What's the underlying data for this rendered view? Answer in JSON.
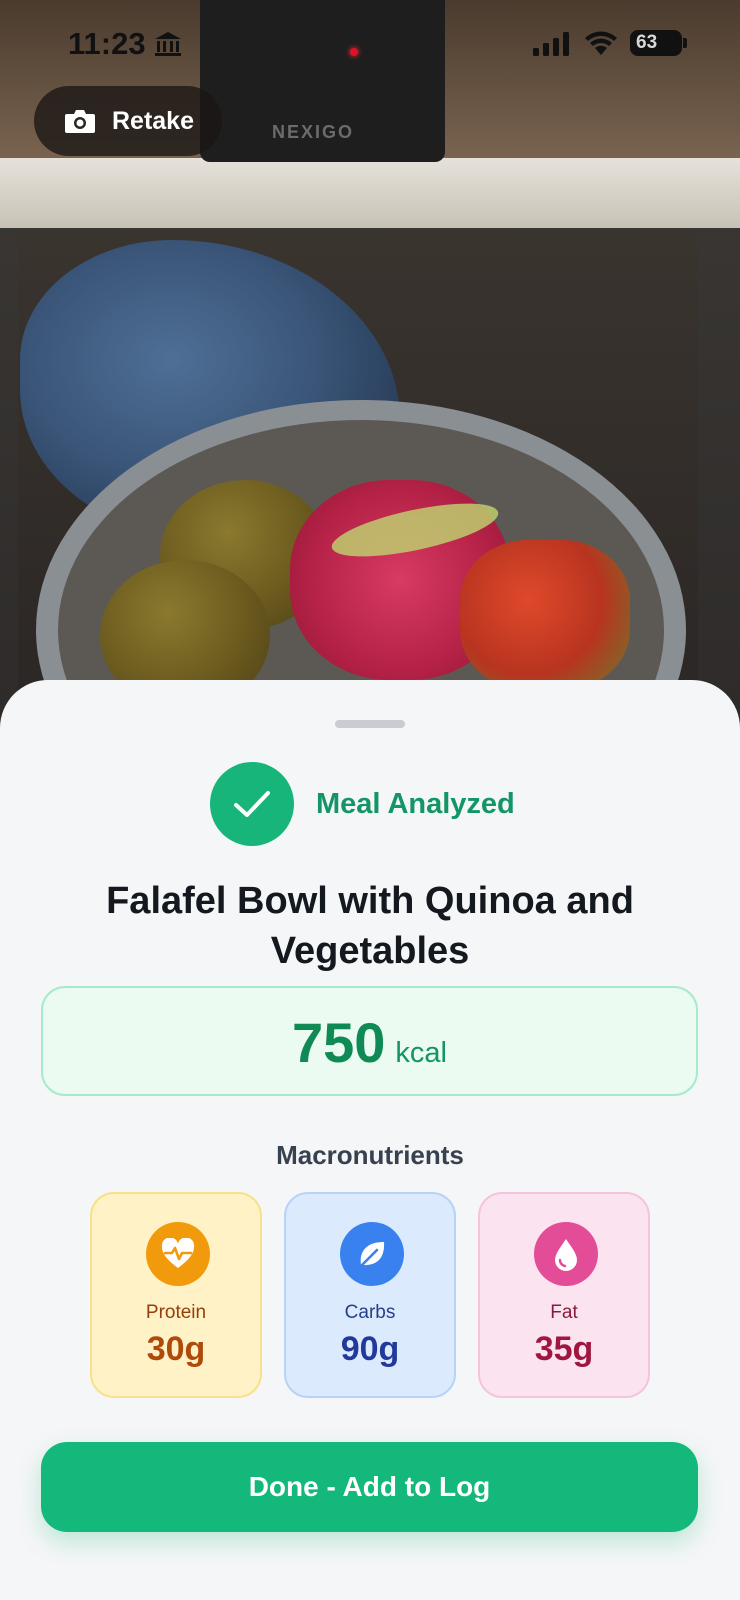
{
  "status_bar": {
    "time": "11:23",
    "battery": "63"
  },
  "header": {
    "retake_label": "Retake"
  },
  "photo": {
    "brand_text": "NEXIGO"
  },
  "result": {
    "status_label": "Meal Analyzed",
    "meal_name": "Falafel Bowl with Quinoa and Vegetables",
    "calories": "750",
    "calories_unit": "kcal"
  },
  "macros": {
    "title": "Macronutrients",
    "items": [
      {
        "label": "Protein",
        "value": "30g",
        "icon": "heart-pulse-icon"
      },
      {
        "label": "Carbs",
        "value": "90g",
        "icon": "leaf-icon"
      },
      {
        "label": "Fat",
        "value": "35g",
        "icon": "droplet-icon"
      }
    ]
  },
  "actions": {
    "done_label": "Done - Add to Log"
  },
  "colors": {
    "accent": "#15b87b",
    "accent_text": "#139565",
    "protein": "#f19b0c",
    "carbs": "#3a81f0",
    "fat": "#e34c97"
  }
}
